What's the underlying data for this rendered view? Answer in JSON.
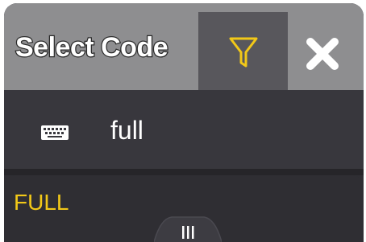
{
  "dialog": {
    "title": "Select Code",
    "filter_icon": "filter-icon",
    "close_icon": "close-icon"
  },
  "search": {
    "icon": "keyboard-icon",
    "value": "full"
  },
  "results": [
    {
      "label": "FULL"
    }
  ],
  "handle": {
    "icon": "grip-icon"
  },
  "colors": {
    "title_bar": "#8e8e90",
    "body": "#2f2e33",
    "accent": "#f2c818",
    "filter_bg": "#58575c"
  }
}
